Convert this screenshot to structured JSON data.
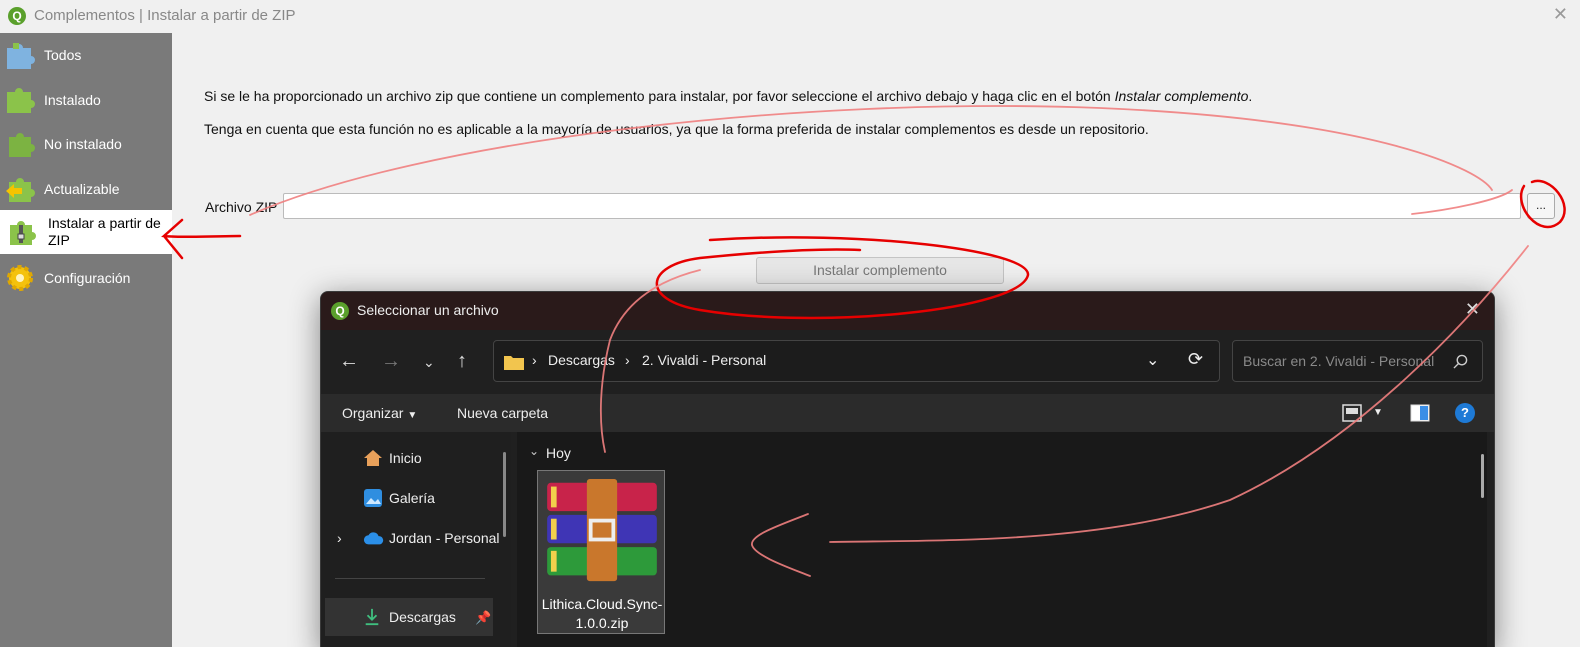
{
  "window": {
    "title": "Complementos | Instalar a partir de ZIP",
    "close": "✕"
  },
  "sidebar": {
    "items": [
      {
        "label": "Todos",
        "icon": "puzzle-all-icon"
      },
      {
        "label": "Instalado",
        "icon": "puzzle-installed-icon"
      },
      {
        "label": "No instalado",
        "icon": "puzzle-not-installed-icon"
      },
      {
        "label": "Actualizable",
        "icon": "puzzle-upgradeable-icon"
      },
      {
        "label": "Instalar a partir de ZIP",
        "icon": "puzzle-zip-icon"
      },
      {
        "label": "Configuración",
        "icon": "gear-icon"
      }
    ]
  },
  "main": {
    "para1_prefix": "Si se le ha proporcionado un archivo zip que contiene un complemento para instalar, por favor seleccione el archivo debajo y haga clic en el botón ",
    "para1_emph": "Instalar complemento",
    "para1_suffix": ".",
    "para2": "Tenga en cuenta que esta función no es aplicable a la mayoría de usuarios, ya que la forma preferida de instalar complementos es desde un repositorio.",
    "zip_label": "Archivo ZIP",
    "zip_value": "",
    "browse_label": "...",
    "install_label": "Instalar complemento"
  },
  "dialog": {
    "title": "Seleccionar un archivo",
    "close": "✕",
    "breadcrumbs": [
      "Descargas",
      "2. Vivaldi - Personal"
    ],
    "search_placeholder": "Buscar en 2. Vivaldi - Personal",
    "toolbar": {
      "organize": "Organizar",
      "new_folder": "Nueva carpeta"
    },
    "nav": [
      {
        "label": "Inicio",
        "icon": "home-icon"
      },
      {
        "label": "Galería",
        "icon": "gallery-icon"
      },
      {
        "label": "Jordan - Personal",
        "icon": "onedrive-cloud-icon"
      },
      {
        "label": "Descargas",
        "icon": "download-icon"
      }
    ],
    "group_label": "Hoy",
    "file": {
      "name": "Lithica.Cloud.Sync-1.0.0.zip",
      "icon": "winrar-archive-icon"
    }
  },
  "colors": {
    "sidebar_bg": "#7a7a7a",
    "annotation_red": "#e60000",
    "dialog_bg": "#202020",
    "dialog_title_bg": "#2a1a1a"
  }
}
